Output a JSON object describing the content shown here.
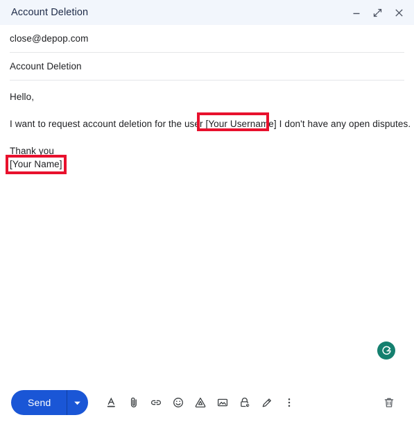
{
  "window": {
    "title": "Account Deletion",
    "controls": [
      {
        "name": "minimize",
        "label": "Minimize"
      },
      {
        "name": "expand",
        "label": "Full screen"
      },
      {
        "name": "close",
        "label": "Save & close"
      }
    ]
  },
  "fields": {
    "recipient": "close@depop.com",
    "subject": "Account Deletion"
  },
  "body": {
    "greeting": "Hello,",
    "request_prefix": "I want to request account deletion for the user ",
    "request_highlight": "[Your Username]",
    "request_suffix": " I don't have any open disputes.",
    "closing": "Thank you",
    "signature": "[Your Name]"
  },
  "annotations": {
    "highlight_color": "#e8112d",
    "username_box_label": "[Your Username]",
    "signature_box_label": "[Your Name]"
  },
  "assistant": {
    "badge_label": "G",
    "badge_color": "#15806f"
  },
  "toolbar": {
    "send_label": "Send",
    "send_color": "#1a56d6",
    "send_dropdown_label": "More send options",
    "items": [
      {
        "name": "formatting-options-icon",
        "label": "Formatting options"
      },
      {
        "name": "attach-file-icon",
        "label": "Attach files"
      },
      {
        "name": "insert-link-icon",
        "label": "Insert link"
      },
      {
        "name": "insert-emoji-icon",
        "label": "Insert emoji"
      },
      {
        "name": "insert-drive-icon",
        "label": "Insert files using Drive"
      },
      {
        "name": "insert-photo-icon",
        "label": "Insert photo"
      },
      {
        "name": "confidential-mode-icon",
        "label": "Toggle confidential mode"
      },
      {
        "name": "insert-signature-icon",
        "label": "Insert signature"
      },
      {
        "name": "more-options-icon",
        "label": "More options"
      }
    ],
    "discard_label": "Discard draft"
  }
}
